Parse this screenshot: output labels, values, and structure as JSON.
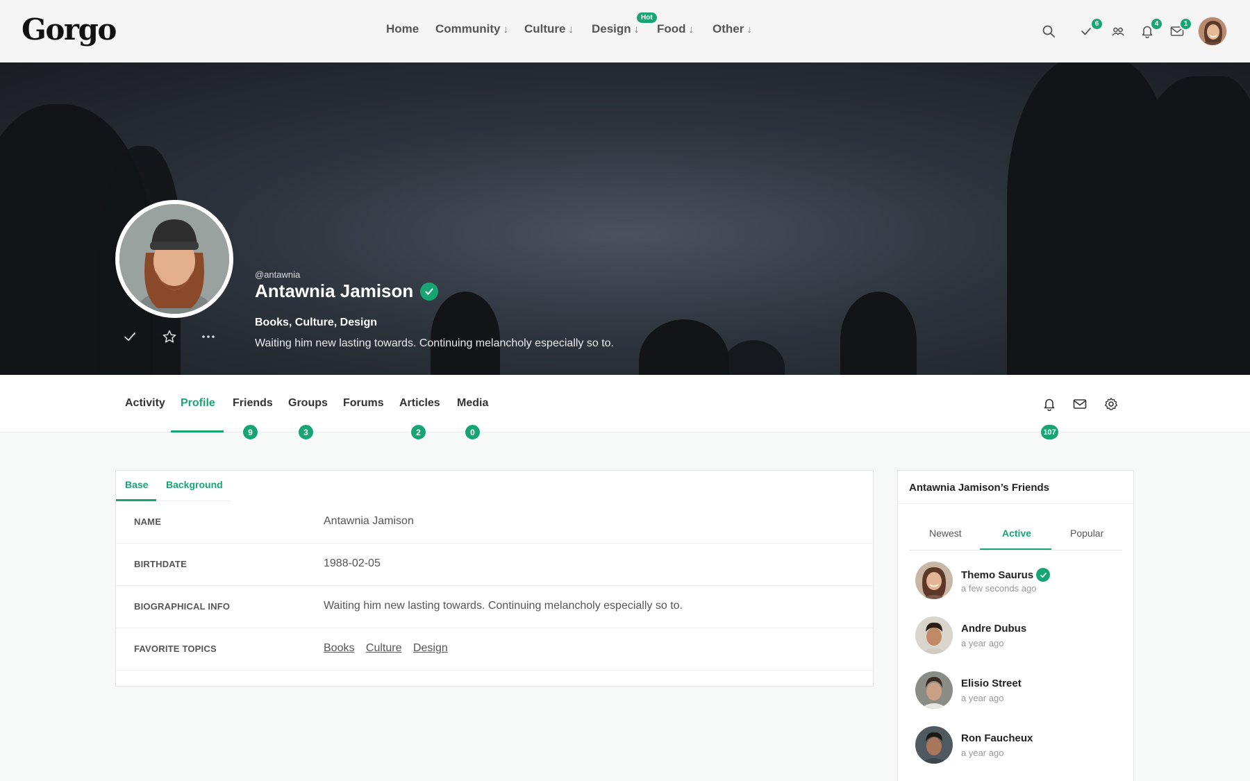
{
  "header": {
    "logo": "Gorgo",
    "nav": [
      {
        "label": "Home",
        "arrow": ""
      },
      {
        "label": "Community",
        "arrow": "↓"
      },
      {
        "label": "Culture",
        "arrow": "↓"
      },
      {
        "label": "Design",
        "arrow": "↓"
      },
      {
        "label": "Food",
        "arrow": "↓"
      },
      {
        "label": "Other",
        "arrow": "↓"
      }
    ],
    "hot_badge": "Hot",
    "icons": {
      "search": "search-icon",
      "check": "check-icon",
      "friends": "friends-icon",
      "bell": "bell-icon",
      "mail": "mail-icon"
    },
    "badges": {
      "check": "6",
      "bell": "4",
      "mail": "1"
    }
  },
  "profile": {
    "handle": "@antawnia",
    "name": "Antawnia Jamison",
    "topics": "Books, Culture, Design",
    "bio": "Waiting him new lasting towards. Continuing melancholy especially so to."
  },
  "profile_tabs": [
    {
      "label": "Activity",
      "badge": ""
    },
    {
      "label": "Profile",
      "badge": ""
    },
    {
      "label": "Friends",
      "badge": "9"
    },
    {
      "label": "Groups",
      "badge": "3"
    },
    {
      "label": "Forums",
      "badge": ""
    },
    {
      "label": "Articles",
      "badge": "2"
    },
    {
      "label": "Media",
      "badge": "0"
    }
  ],
  "notifications_badge": "107",
  "details": {
    "tabs": [
      "Base",
      "Background"
    ],
    "rows": [
      {
        "label": "NAME",
        "value": "Antawnia Jamison"
      },
      {
        "label": "BIRTHDATE",
        "value": "1988-02-05"
      },
      {
        "label": "BIOGRAPHICAL INFO",
        "value": "Waiting him new lasting towards. Continuing melancholy especially so to."
      },
      {
        "label": "FAVORITE TOPICS",
        "value": ""
      }
    ],
    "favorite_topics": [
      "Books",
      "Culture",
      "Design"
    ]
  },
  "friends": {
    "title": "Antawnia Jamison’s Friends",
    "tabs": [
      "Newest",
      "Active",
      "Popular"
    ],
    "items": [
      {
        "name": "Themo Saurus",
        "time": "a few seconds ago",
        "verified": true
      },
      {
        "name": "Andre Dubus",
        "time": "a year ago",
        "verified": false
      },
      {
        "name": "Elisio Street",
        "time": "a year ago",
        "verified": false
      },
      {
        "name": "Ron Faucheux",
        "time": "a year ago",
        "verified": false
      }
    ]
  },
  "colors": {
    "accent": "#17a673",
    "header_bg": "#f5f5f5",
    "page_bg": "#f7f8f8"
  }
}
